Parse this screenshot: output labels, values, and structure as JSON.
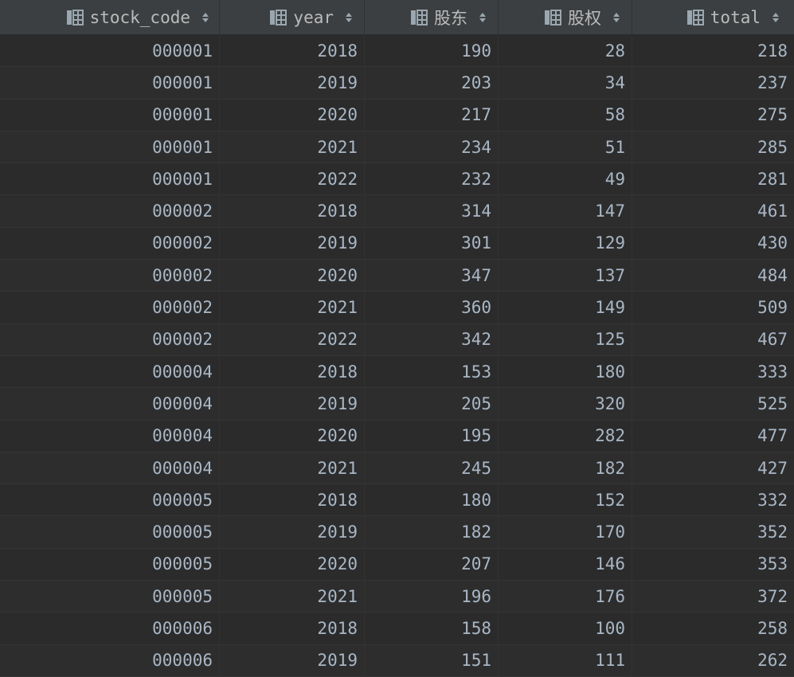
{
  "table": {
    "columns": [
      {
        "label": "stock_code",
        "icon": "column-icon",
        "sort_icon": "sort-icon"
      },
      {
        "label": "year",
        "icon": "column-icon",
        "sort_icon": "sort-icon"
      },
      {
        "label": "股东",
        "icon": "column-icon",
        "sort_icon": "sort-icon"
      },
      {
        "label": "股权",
        "icon": "column-icon",
        "sort_icon": "sort-icon"
      },
      {
        "label": "total",
        "icon": "column-icon",
        "sort_icon": "sort-icon"
      }
    ],
    "rows": [
      [
        "000001",
        "2018",
        "190",
        "28",
        "218"
      ],
      [
        "000001",
        "2019",
        "203",
        "34",
        "237"
      ],
      [
        "000001",
        "2020",
        "217",
        "58",
        "275"
      ],
      [
        "000001",
        "2021",
        "234",
        "51",
        "285"
      ],
      [
        "000001",
        "2022",
        "232",
        "49",
        "281"
      ],
      [
        "000002",
        "2018",
        "314",
        "147",
        "461"
      ],
      [
        "000002",
        "2019",
        "301",
        "129",
        "430"
      ],
      [
        "000002",
        "2020",
        "347",
        "137",
        "484"
      ],
      [
        "000002",
        "2021",
        "360",
        "149",
        "509"
      ],
      [
        "000002",
        "2022",
        "342",
        "125",
        "467"
      ],
      [
        "000004",
        "2018",
        "153",
        "180",
        "333"
      ],
      [
        "000004",
        "2019",
        "205",
        "320",
        "525"
      ],
      [
        "000004",
        "2020",
        "195",
        "282",
        "477"
      ],
      [
        "000004",
        "2021",
        "245",
        "182",
        "427"
      ],
      [
        "000005",
        "2018",
        "180",
        "152",
        "332"
      ],
      [
        "000005",
        "2019",
        "182",
        "170",
        "352"
      ],
      [
        "000005",
        "2020",
        "207",
        "146",
        "353"
      ],
      [
        "000005",
        "2021",
        "196",
        "176",
        "372"
      ],
      [
        "000006",
        "2018",
        "158",
        "100",
        "258"
      ],
      [
        "000006",
        "2019",
        "151",
        "111",
        "262"
      ]
    ]
  },
  "colors": {
    "background": "#2b2b2b",
    "header_background": "#3c3f41",
    "text": "#a9b7c6",
    "header_text": "#bbbbbb"
  }
}
